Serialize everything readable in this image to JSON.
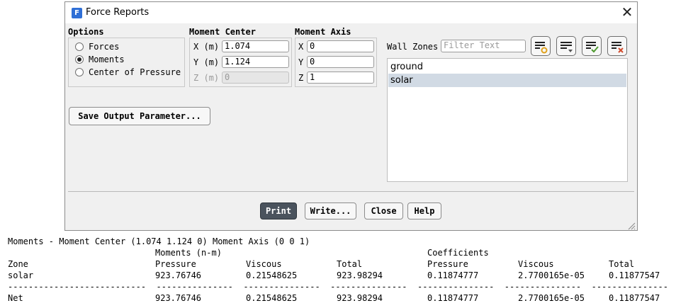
{
  "window": {
    "title": "Force Reports",
    "app_icon_glyph": "F"
  },
  "options": {
    "label": "Options",
    "items": [
      {
        "label": "Forces",
        "selected": false
      },
      {
        "label": "Moments",
        "selected": true
      },
      {
        "label": "Center of Pressure",
        "selected": false
      }
    ]
  },
  "moment_center": {
    "label": "Moment Center",
    "rows": [
      {
        "label": "X (m)",
        "value": "1.074",
        "enabled": true
      },
      {
        "label": "Y (m)",
        "value": "1.124",
        "enabled": true
      },
      {
        "label": "Z (m)",
        "value": "0",
        "enabled": false
      }
    ]
  },
  "moment_axis": {
    "label": "Moment Axis",
    "rows": [
      {
        "label": "X",
        "value": "0"
      },
      {
        "label": "Y",
        "value": "0"
      },
      {
        "label": "Z",
        "value": "1"
      }
    ]
  },
  "wall_zones": {
    "label": "Wall Zones",
    "filter_placeholder": "Filter Text",
    "items": [
      {
        "label": "ground",
        "selected": false
      },
      {
        "label": "solar",
        "selected": true
      }
    ]
  },
  "save_output_label": "Save Output Parameter...",
  "buttons": {
    "print": "Print",
    "write": "Write...",
    "close": "Close",
    "help": "Help"
  },
  "output": {
    "header_line": "Moments - Moment Center (1.074 1.124 0) Moment Axis (0 0 1)",
    "group_moments": "Moments (n-m)",
    "group_coefficients": "Coefficients",
    "columns": [
      "Zone",
      "Pressure",
      "Viscous",
      "Total",
      "Pressure",
      "Viscous",
      "Total"
    ],
    "rows": [
      [
        "solar",
        "923.76746",
        "0.21548625",
        "923.98294",
        "0.11874777",
        "2.7700165e-05",
        "0.11877547"
      ]
    ],
    "separator": "---------------------------  ---------------  ---------------  ---------------  ---------------  ---------------  ---------------",
    "net_row": [
      "Net",
      "923.76746",
      "0.21548625",
      "923.98294",
      "0.11874777",
      "2.7700165e-05",
      "0.11877547"
    ]
  },
  "colors": {
    "primary_button": "#4a535d",
    "selected_row": "#d1dae4",
    "icon_blue": "#2f6fd6",
    "icon_orange": "#e0a11b",
    "icon_green": "#4e9a2f",
    "icon_red": "#d24b2c"
  }
}
